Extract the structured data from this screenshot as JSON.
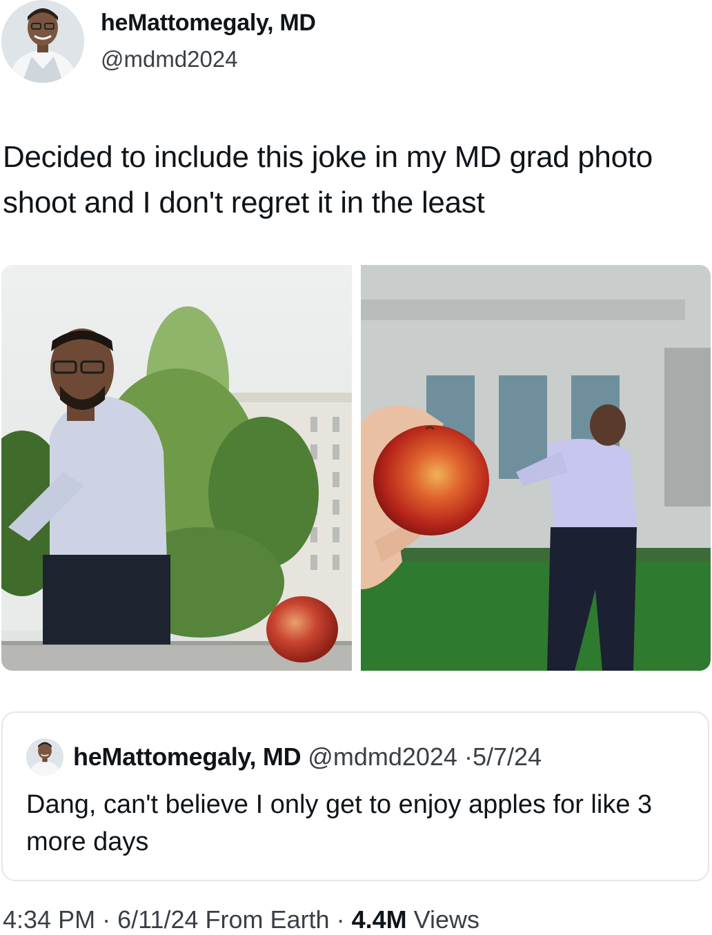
{
  "author": {
    "display_name": "heMattomegaly, MD",
    "handle": "@mdmd2024",
    "avatar_icon": "profile-photo-icon"
  },
  "tweet": {
    "text": "Decided to include this joke in my MD grad photo shoot and I don't regret it in the least"
  },
  "media": [
    {
      "alt": "photo-man-looking-at-apple"
    },
    {
      "alt": "photo-hand-holding-apple"
    }
  ],
  "quote": {
    "display_name": "heMattomegaly, MD",
    "handle": "@mdmd2024",
    "separator": "·",
    "date": "5/7/24",
    "text": "Dang, can't believe I only get to enjoy apples for like 3 more days"
  },
  "footer": {
    "time": "4:34 PM",
    "date": "6/11/24",
    "source": "From Earth",
    "views_count": "4.4M",
    "views_label": "Views"
  }
}
